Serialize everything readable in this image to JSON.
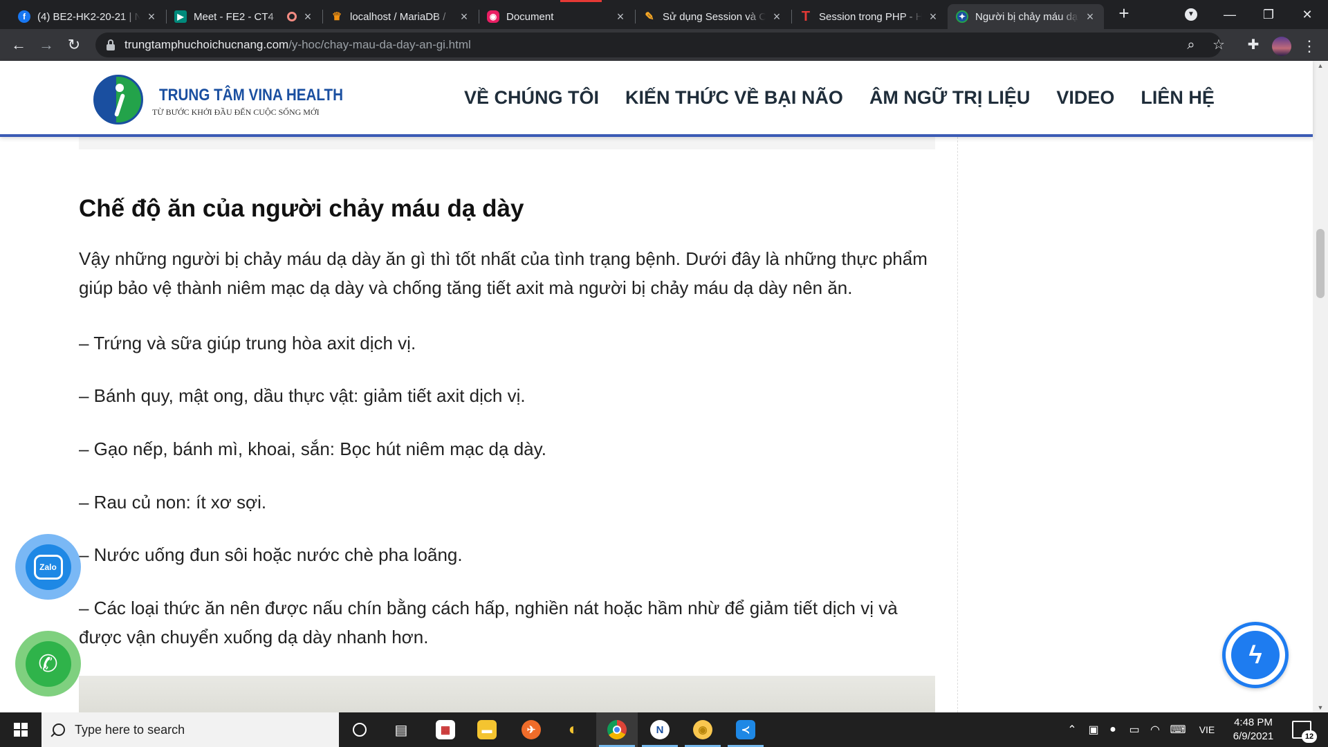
{
  "browser": {
    "tabs": [
      {
        "title": "(4) BE2-HK2-20-21 | N",
        "favicon_color": "#1877f2",
        "favicon_glyph": "f",
        "icon": "facebook-icon"
      },
      {
        "title": "Meet - FE2 - CT4",
        "favicon_color": "#00897b",
        "favicon_glyph": "▶",
        "icon": "google-meet-icon"
      },
      {
        "title": "localhost / MariaDB / ",
        "favicon_color": "#f29111",
        "favicon_glyph": "♛",
        "icon": "phpmyadmin-icon"
      },
      {
        "title": "Document",
        "favicon_color": "#e91e63",
        "favicon_glyph": "◉",
        "icon": "document-icon"
      },
      {
        "title": "Sử dụng Session và C",
        "favicon_color": "#f9a825",
        "favicon_glyph": "✎",
        "icon": "article-icon"
      },
      {
        "title": "Session trong PHP - H",
        "favicon_color": "#e53935",
        "favicon_glyph": "T",
        "icon": "t-icon"
      },
      {
        "title": "Người bị chảy máu dạ",
        "favicon_color": "#1a4fa0",
        "favicon_glyph": "✦",
        "icon": "vina-health-icon"
      }
    ],
    "new_tab_label": "+",
    "url_host": "trungtamphuchoichucnang.com",
    "url_path": "/y-hoc/chay-mau-da-day-an-gi.html"
  },
  "site": {
    "logo_title": "TRUNG TÂM VINA HEALTH",
    "logo_subtitle": "TỪ BƯỚC KHỞI ĐẦU ĐẾN CUỘC SỐNG MỚI",
    "nav": [
      "VỀ CHÚNG TÔI",
      "KIẾN THỨC VỀ BẠI NÃO",
      "ÂM NGỮ TRỊ LIỆU",
      "VIDEO",
      "LIÊN HỆ"
    ]
  },
  "article": {
    "heading": "Chế độ ăn của người chảy máu dạ dày",
    "intro": "Vậy những người bị chảy máu dạ dày ăn gì thì tốt nhất của tình trạng bệnh. Dưới đây là những thực phẩm giúp bảo vệ thành niêm mạc dạ dày và chống tăng tiết axit mà người bị chảy máu dạ dày nên ăn.",
    "items": [
      "– Trứng và sữa giúp trung hòa axit dịch vị.",
      "– Bánh quy, mật ong, dầu thực vật: giảm tiết axit dịch vị.",
      "– Gạo nếp, bánh mì, khoai, sắn: Bọc hút niêm mạc dạ dày.",
      "– Rau củ non: ít xơ sợi.",
      "– Nước uống đun sôi hoặc nước chè pha loãng.",
      "– Các loại thức ăn nên được nấu chín bằng cách hấp, nghiền nát hoặc hầm nhừ để giảm tiết dịch vị và được vận chuyển xuống dạ dày nhanh hơn."
    ]
  },
  "floating": {
    "zalo_label": "Zalo"
  },
  "taskbar": {
    "search_placeholder": "Type here to search",
    "language": "VIE",
    "time": "4:48 PM",
    "date": "6/9/2021",
    "notifications": "12"
  }
}
